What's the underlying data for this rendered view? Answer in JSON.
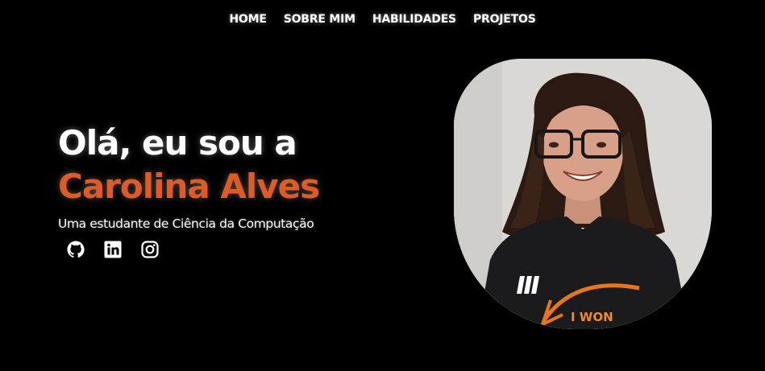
{
  "nav": {
    "items": [
      {
        "label": "HOME"
      },
      {
        "label": "SOBRE MIM"
      },
      {
        "label": "HABILIDADES"
      },
      {
        "label": "PROJETOS"
      }
    ]
  },
  "hero": {
    "greeting": "Olá, eu sou a",
    "name": "Carolina Alves",
    "subtitle": "Uma estudante de Ciência da Computação",
    "socials": [
      {
        "icon": "github-icon"
      },
      {
        "icon": "linkedin-icon"
      },
      {
        "icon": "instagram-icon"
      }
    ]
  },
  "photo": {
    "shirt_text": "I WON"
  },
  "colors": {
    "background": "#000000",
    "accent": "#e05a25",
    "text": "#ffffff"
  }
}
